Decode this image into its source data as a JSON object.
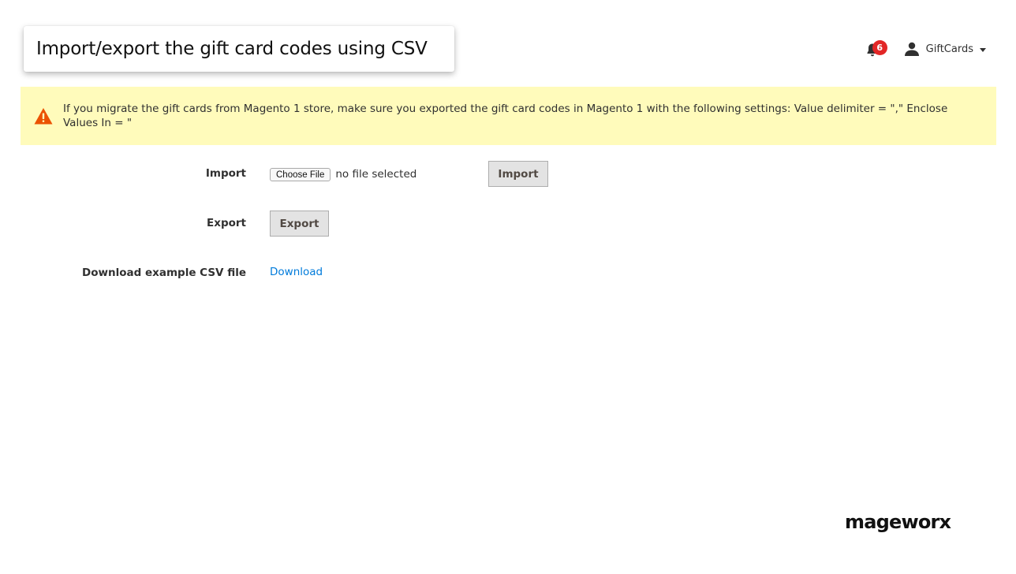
{
  "title_card": {
    "title": "Import/export the gift card codes using CSV"
  },
  "header": {
    "notifications": {
      "icon": "bell-icon",
      "count": "6",
      "badge_color": "#e22626"
    },
    "account": {
      "icon": "user-icon",
      "name": "GiftCards"
    }
  },
  "message": {
    "type": "warning",
    "icon": "warning-triangle-icon",
    "text": "If you migrate the gift cards from Magento 1 store, make sure you exported the gift card codes in Magento 1 with the following settings: Value delimiter = \",\" Enclose Values In = \"",
    "background_color": "#fffbbb",
    "icon_color": "#eb5202"
  },
  "form": {
    "import": {
      "label": "Import",
      "file_button_label": "Choose File",
      "file_status": "no file selected",
      "button_label": "Import"
    },
    "export": {
      "label": "Export",
      "button_label": "Export"
    },
    "download": {
      "label": "Download example CSV file",
      "link_label": "Download",
      "link_color": "#007bdb"
    }
  },
  "brand": {
    "logo_text": "mageworx"
  }
}
